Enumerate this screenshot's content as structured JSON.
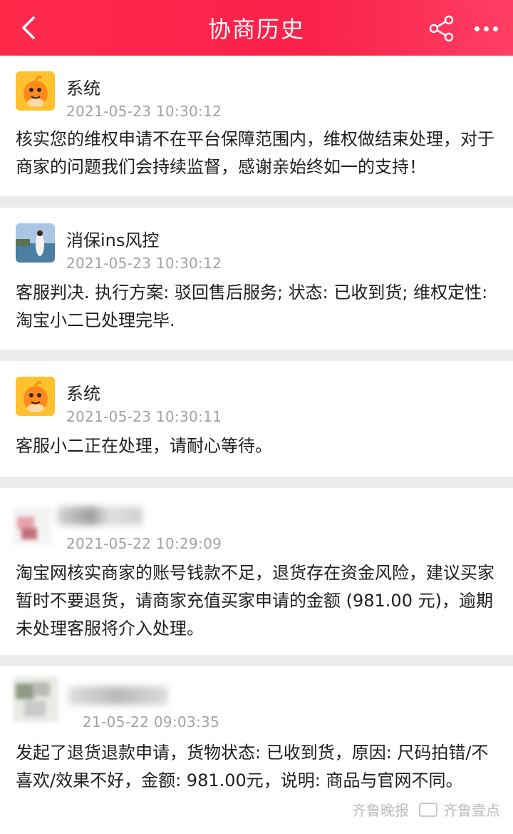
{
  "header": {
    "title": "协商历史",
    "back_icon": "back-arrow-icon",
    "share_icon": "share-icon",
    "more_icon": "more-dots-icon"
  },
  "messages": [
    {
      "name": "系统",
      "time": "2021-05-23 10:30:12",
      "text": "核实您的维权申请不在平台保障范围内，维权做结束处理，对于商家的问题我们会持续监督，感谢亲始终如一的支持！",
      "avatar": "system-mascot-avatar"
    },
    {
      "name": "消保ins风控",
      "time": "2021-05-23 10:30:12",
      "text": "客服判决. 执行方案: 驳回售后服务; 状态: 已收到货; 维权定性: 淘宝小二已处理完毕.",
      "avatar": "photo-avatar"
    },
    {
      "name": "系统",
      "time": "2021-05-23 10:30:11",
      "text": "客服小二正在处理，请耐心等待。",
      "avatar": "system-mascot-avatar"
    },
    {
      "name": "",
      "time": "2021-05-22 10:29:09",
      "text": "淘宝网核实商家的账号钱款不足，退货存在资金风险，建议买家暂时不要退货，请商家充值买家申请的金额 (981.00 元)，逾期未处理客服将介入处理。",
      "avatar": "blurred-avatar"
    },
    {
      "name": "",
      "time": "21-05-22 09:03:35",
      "text": "发起了退货退款申请，货物状态: 已收到货，原因: 尺码拍错/不喜欢/效果不好，金额: 981.00元，说明: 商品与官网不同。",
      "avatar": "blurred-avatar"
    }
  ],
  "watermark": {
    "text1": "齐鲁晚报",
    "text2": "齐鲁壹点"
  },
  "colors": {
    "header_bg": "#f92149",
    "time_text": "#a2a2a2",
    "page_bg": "#ececec"
  }
}
